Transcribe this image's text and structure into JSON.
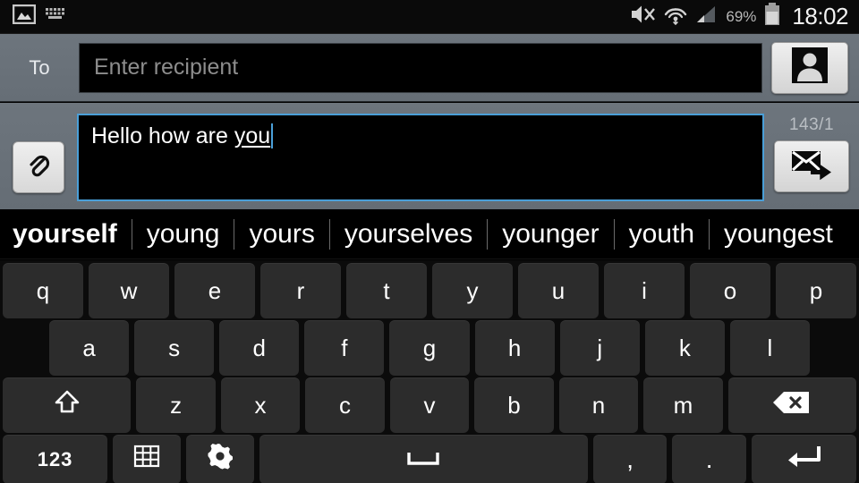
{
  "statusbar": {
    "left_icons": [
      {
        "name": "image-icon",
        "label": "image"
      },
      {
        "name": "keyboard-icon",
        "label": "keyboard"
      }
    ],
    "right_icons": [
      {
        "name": "sound-mute-icon",
        "label": "mute"
      },
      {
        "name": "wifi-icon",
        "label": "wifi"
      },
      {
        "name": "cellular-signal-icon",
        "label": "signal"
      }
    ],
    "battery_percent": "69%",
    "battery_icon": "battery-icon",
    "clock": "18:02"
  },
  "recipient": {
    "label": "To",
    "placeholder": "Enter recipient",
    "value": "",
    "contacts_button_icon": "contact-person-icon"
  },
  "compose": {
    "attach_button_icon": "paperclip-icon",
    "message_prefix": "Hello how are ",
    "message_composing_word": "you",
    "char_counter": "143/1",
    "send_button_icon": "send-envelope-icon"
  },
  "suggestions": [
    "yourself",
    "young",
    "yours",
    "yourselves",
    "younger",
    "youth",
    "youngest"
  ],
  "keyboard": {
    "row1": [
      "q",
      "w",
      "e",
      "r",
      "t",
      "y",
      "u",
      "i",
      "o",
      "p"
    ],
    "row2": [
      "a",
      "s",
      "d",
      "f",
      "g",
      "h",
      "j",
      "k",
      "l"
    ],
    "row3": {
      "shift_icon": "shift-arrow-icon",
      "letters": [
        "z",
        "x",
        "c",
        "v",
        "b",
        "n",
        "m"
      ],
      "backspace_icon": "backspace-icon"
    },
    "row4": {
      "numeric_label": "123",
      "layout_icon": "keyboard-grid-icon",
      "settings_icon": "gear-icon",
      "space_icon": "space-bar-icon",
      "comma": ",",
      "period": ".",
      "enter_icon": "enter-return-icon"
    }
  },
  "colors": {
    "accent_blue": "#4a9fd8",
    "chrome_gray": "#6d757d",
    "key_gray": "#2c2c2c",
    "background_black": "#000000"
  }
}
